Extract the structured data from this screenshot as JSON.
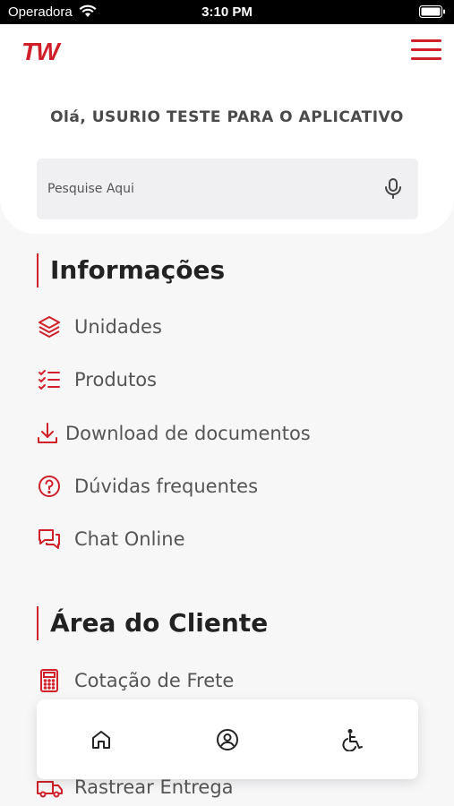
{
  "status_bar": {
    "carrier": "Operadora",
    "time": "3:10 PM"
  },
  "header": {
    "logo": "TW"
  },
  "greeting": "Olá, USURIO TESTE PARA O APLICATIVO",
  "search": {
    "placeholder": "Pesquise Aqui"
  },
  "sections": [
    {
      "title": "Informações",
      "items": [
        {
          "label": "Unidades",
          "icon": "layers-icon"
        },
        {
          "label": "Produtos",
          "icon": "checklist-icon"
        },
        {
          "label": "Download de documentos",
          "icon": "download-icon"
        },
        {
          "label": "Dúvidas frequentes",
          "icon": "question-icon"
        },
        {
          "label": "Chat Online",
          "icon": "chat-icon"
        }
      ]
    },
    {
      "title": "Área do Cliente",
      "items": [
        {
          "label": "Cotação de Frete",
          "icon": "calculator-icon"
        },
        {
          "label": "Rastrear Entrega",
          "icon": "truck-icon"
        }
      ]
    }
  ],
  "bottom_nav": [
    "home-icon",
    "user-circle-icon",
    "accessibility-icon"
  ],
  "colors": {
    "accent": "#d0202a",
    "background": "#f7f7f8"
  }
}
